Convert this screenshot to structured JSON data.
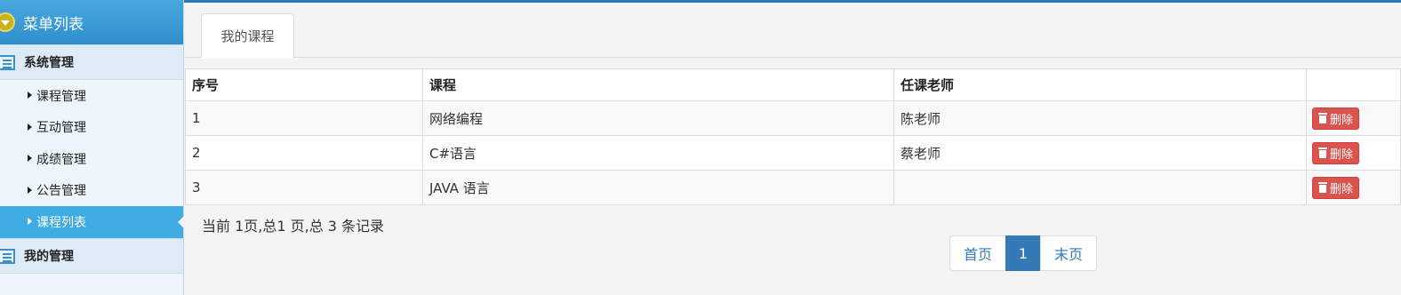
{
  "sidebar": {
    "title": "菜单列表",
    "groups": [
      {
        "label": "系统管理",
        "items": [
          {
            "label": "课程管理"
          },
          {
            "label": "互动管理"
          },
          {
            "label": "成绩管理"
          },
          {
            "label": "公告管理"
          },
          {
            "label": "课程列表",
            "active": true
          }
        ]
      },
      {
        "label": "我的管理",
        "items": []
      }
    ]
  },
  "tabs": [
    {
      "label": "我的课程",
      "active": true
    }
  ],
  "table": {
    "headers": [
      "序号",
      "课程",
      "任课老师",
      ""
    ],
    "rows": [
      {
        "index": "1",
        "course": "网络编程",
        "teacher": "陈老师",
        "action": "删除"
      },
      {
        "index": "2",
        "course": "C#语言",
        "teacher": "蔡老师",
        "action": "删除"
      },
      {
        "index": "3",
        "course": "JAVA 语言",
        "teacher": "",
        "action": "删除"
      }
    ]
  },
  "summary": "当前 1页,总1 页,总 3 条记录",
  "pagination": {
    "first": "首页",
    "current": "1",
    "last": "末页"
  },
  "colors": {
    "accent": "#337ab7",
    "danger": "#d9534f",
    "sidebar_active": "#3eabe3"
  }
}
